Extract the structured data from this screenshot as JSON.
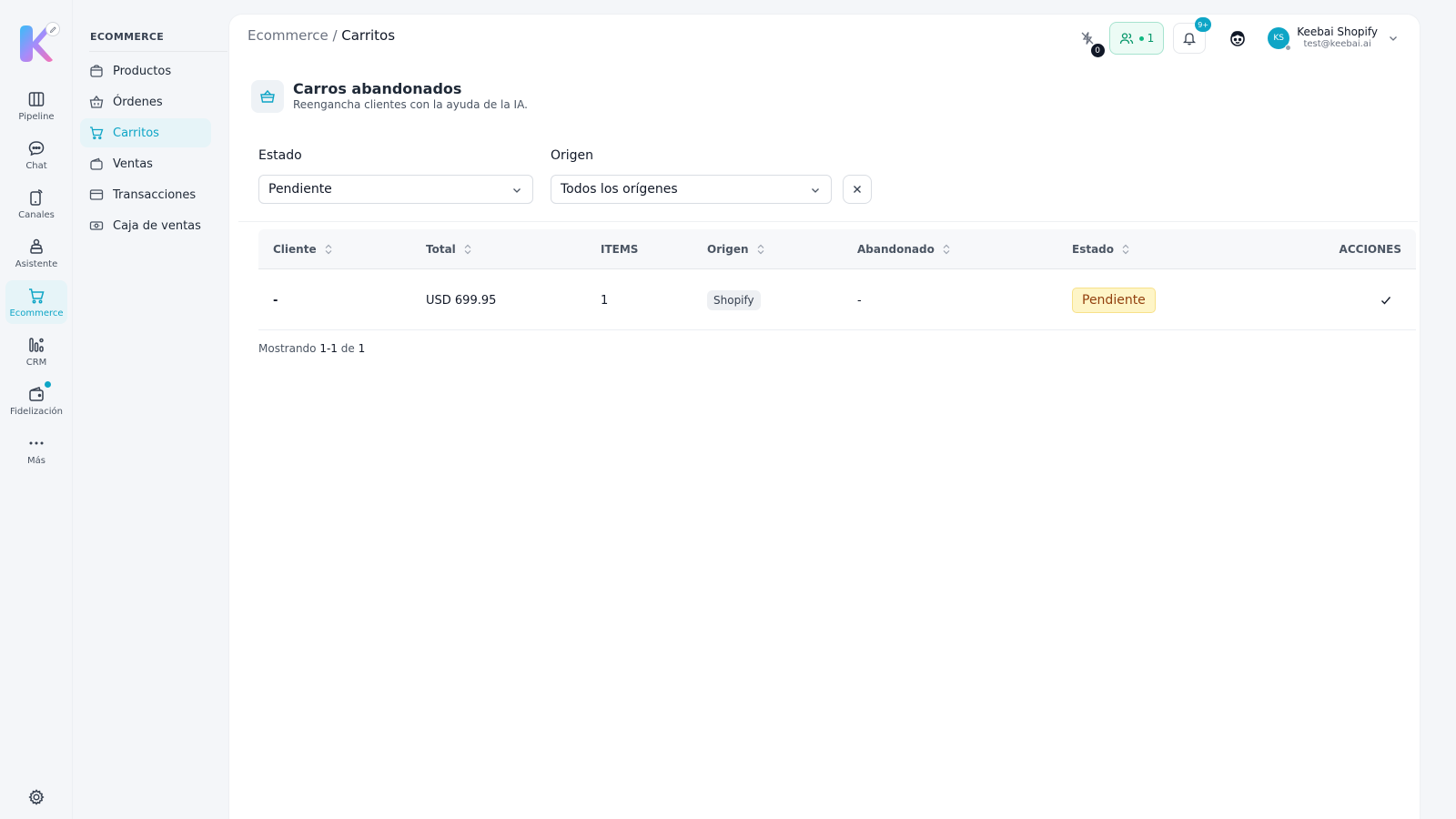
{
  "rail": {
    "items": [
      {
        "label": "Pipeline",
        "icon": "columns-icon"
      },
      {
        "label": "Chat",
        "icon": "chat-bubble-icon"
      },
      {
        "label": "Canales",
        "icon": "phone-signal-icon"
      },
      {
        "label": "Asistente",
        "icon": "assistant-icon"
      },
      {
        "label": "Ecommerce",
        "icon": "cart-icon"
      },
      {
        "label": "CRM",
        "icon": "bar-chart-icon"
      },
      {
        "label": "Fidelización",
        "icon": "wallet-icon"
      },
      {
        "label": "Más",
        "icon": "more-dots-icon"
      }
    ],
    "active": "Ecommerce",
    "accent": "#0ea5c6"
  },
  "submenu": {
    "title": "ECOMMERCE",
    "items": [
      {
        "label": "Productos",
        "icon": "bag-icon"
      },
      {
        "label": "Órdenes",
        "icon": "basket-icon"
      },
      {
        "label": "Carritos",
        "icon": "cart-icon"
      },
      {
        "label": "Ventas",
        "icon": "wallet-icon"
      },
      {
        "label": "Transacciones",
        "icon": "credit-card-icon"
      },
      {
        "label": "Caja de ventas",
        "icon": "cash-icon"
      }
    ],
    "active": "Carritos"
  },
  "breadcrumb": {
    "parent": "Ecommerce",
    "separator": " / ",
    "current": "Carritos"
  },
  "topbar": {
    "flash_count": "0",
    "users_online": "1",
    "notifications": "9+",
    "user": {
      "initials": "KS",
      "name": "Keebai Shopify",
      "email": "test@keebai.ai"
    }
  },
  "page": {
    "title": "Carros abandonados",
    "subtitle": "Reengancha clientes con la ayuda de la IA."
  },
  "filters": {
    "estado_label": "Estado",
    "estado_value": "Pendiente",
    "origen_label": "Origen",
    "origen_value": "Todos los orígenes"
  },
  "table": {
    "headers": {
      "cliente": "Cliente",
      "total": "Total",
      "items": "ITEMS",
      "origen": "Origen",
      "abandonado": "Abandonado",
      "estado": "Estado",
      "acciones": "ACCIONES"
    },
    "rows": [
      {
        "cliente": "-",
        "total": "USD 699.95",
        "items": "1",
        "origen": "Shopify",
        "abandonado": "-",
        "estado": "Pendiente"
      }
    ]
  },
  "pagination": {
    "prefix": "Mostrando ",
    "range": "1-1",
    "of": " de ",
    "total": "1"
  }
}
